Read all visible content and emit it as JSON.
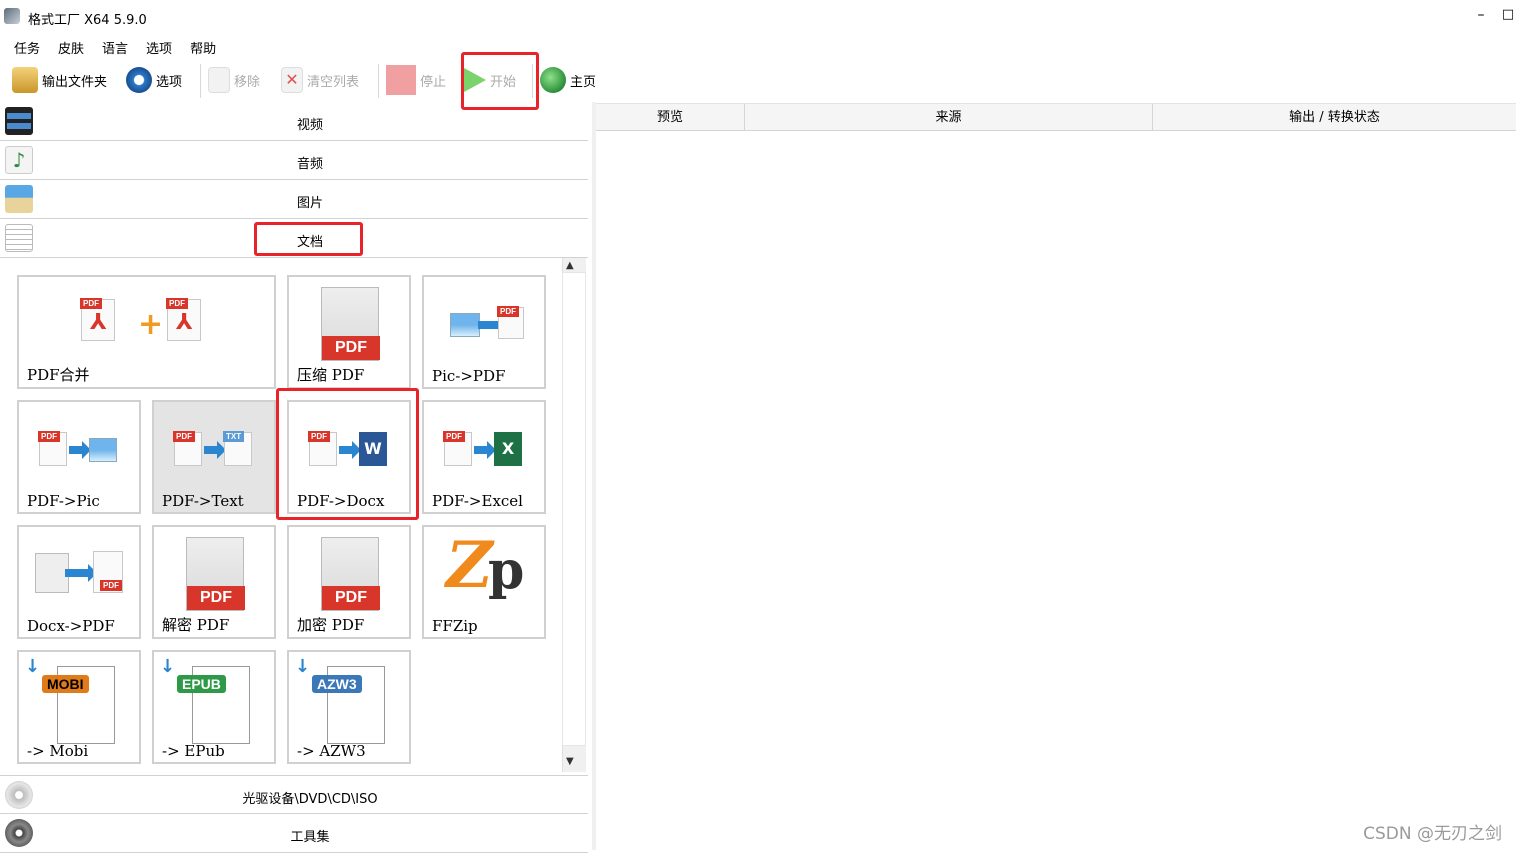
{
  "window": {
    "title": "格式工厂 X64 5.9.0",
    "minimize_glyph": "–",
    "maximize_glyph": "□"
  },
  "menu": [
    "任务",
    "皮肤",
    "语言",
    "选项",
    "帮助"
  ],
  "toolbar": {
    "output_folder": "输出文件夹",
    "options": "选项",
    "remove": "移除",
    "clear_list": "清空列表",
    "stop": "停止",
    "start": "开始",
    "home": "主页"
  },
  "categories": {
    "video": "视频",
    "audio": "音频",
    "image": "图片",
    "document": "文档",
    "optical": "光驱设备\\DVD\\CD\\ISO",
    "tools": "工具集"
  },
  "tiles": {
    "pdf_merge": "PDF合并",
    "compress_pdf": "压缩 PDF",
    "pic_to_pdf": "Pic->PDF",
    "pdf_to_pic": "PDF->Pic",
    "pdf_to_text": "PDF->Text",
    "pdf_to_docx": "PDF->Docx",
    "pdf_to_excel": "PDF->Excel",
    "docx_to_pdf": "Docx->PDF",
    "decrypt_pdf": "解密 PDF",
    "encrypt_pdf": "加密 PDF",
    "ffzip": "FFZip",
    "to_mobi": "-> Mobi",
    "to_epub": "-> EPub",
    "to_azw3": "-> AZW3"
  },
  "art_text": {
    "pdf": "PDF",
    "txt": "TXT",
    "word": "W",
    "excel": "X",
    "mobi": "MOBI",
    "epub": "EPUB",
    "azw3": "AZW3",
    "zip_z": "Z",
    "zip_p": "p"
  },
  "scroll": {
    "up": "▲",
    "down": "▼"
  },
  "list_columns": [
    "预览",
    "来源",
    "输出 / 转换状态"
  ],
  "watermark": "CSDN @无刃之剑",
  "colors": {
    "highlight": "#e8242a",
    "pdf_red": "#d9362b",
    "word_blue": "#2b5797",
    "excel_green": "#1e7145"
  }
}
